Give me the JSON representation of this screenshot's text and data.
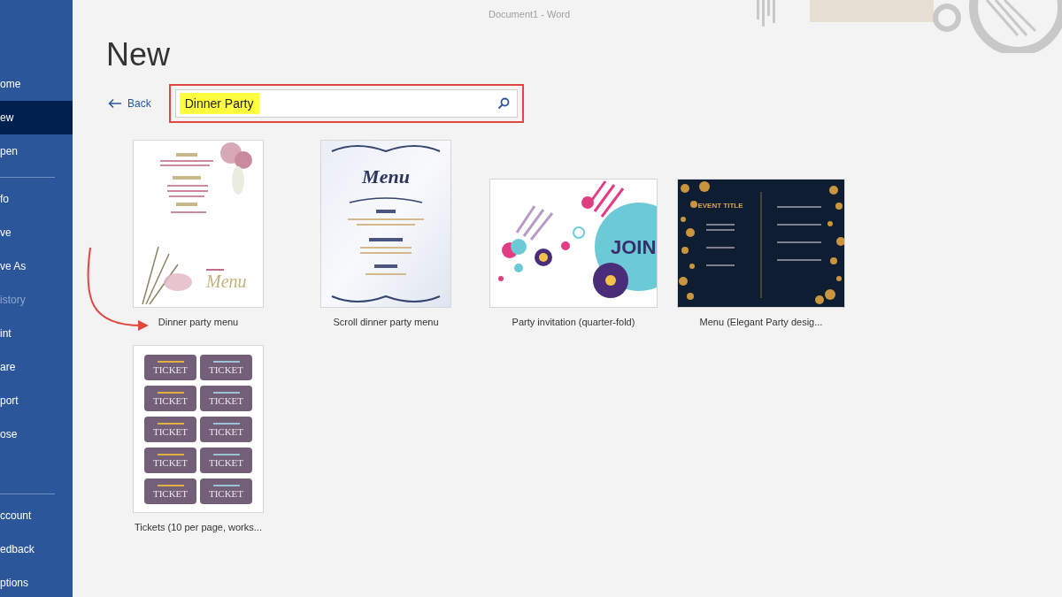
{
  "window": {
    "title": "Document1 - Word"
  },
  "sidebar": {
    "groups": [
      {
        "items": [
          {
            "label": "ome",
            "selected": false,
            "disabled": false
          },
          {
            "label": "ew",
            "selected": true,
            "disabled": false
          },
          {
            "label": "pen",
            "selected": false,
            "disabled": false
          }
        ]
      },
      {
        "items": [
          {
            "label": "fo",
            "selected": false,
            "disabled": false
          },
          {
            "label": "ve",
            "selected": false,
            "disabled": false
          },
          {
            "label": "ve As",
            "selected": false,
            "disabled": false
          },
          {
            "label": "istory",
            "selected": false,
            "disabled": true
          },
          {
            "label": "int",
            "selected": false,
            "disabled": false
          },
          {
            "label": "are",
            "selected": false,
            "disabled": false
          },
          {
            "label": "port",
            "selected": false,
            "disabled": false
          },
          {
            "label": "ose",
            "selected": false,
            "disabled": false
          }
        ]
      },
      {
        "items": [
          {
            "label": "ccount",
            "selected": false,
            "disabled": false
          },
          {
            "label": "edback",
            "selected": false,
            "disabled": false
          },
          {
            "label": "ptions",
            "selected": false,
            "disabled": false
          }
        ]
      }
    ]
  },
  "page_title": "New",
  "back_link": "Back",
  "search": {
    "value": "Dinner Party",
    "highlighted": true,
    "outlined": true
  },
  "templates": [
    {
      "name": "Dinner party menu",
      "kind": "floral-menu",
      "preview_words": [
        "Menu"
      ],
      "pointed": true
    },
    {
      "name": "Scroll dinner party menu",
      "kind": "scroll-menu",
      "preview_words": [
        "Menu"
      ],
      "pointed": false
    },
    {
      "name": "Party invitation (quarter-fold)",
      "kind": "invitation",
      "preview_words": [
        "JOIN"
      ],
      "pointed": false
    },
    {
      "name": "Menu (Elegant Party desig...",
      "kind": "dark-menu",
      "preview_words": [
        "EVENT TITLE"
      ],
      "pointed": false
    },
    {
      "name": "Tickets (10 per page, works...",
      "kind": "tickets",
      "preview_words": [
        "TICKET",
        "TICKET",
        "TICKET",
        "TICKET",
        "TICKET",
        "TICKET",
        "TICKET",
        "TICKET",
        "TICKET",
        "TICKET"
      ],
      "pointed": false
    }
  ]
}
